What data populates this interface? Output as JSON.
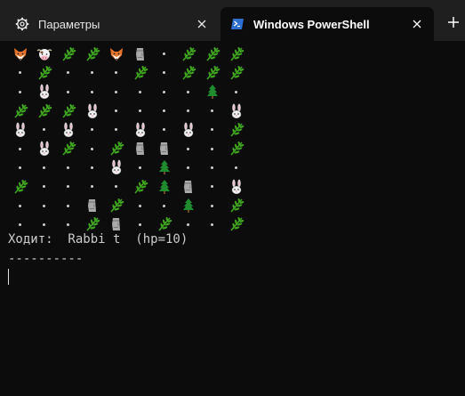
{
  "tabs": [
    {
      "label": "Параметры",
      "icon": "gear-icon",
      "active": false
    },
    {
      "label": "Windows PowerShell",
      "icon": "powershell-icon",
      "active": true
    }
  ],
  "terminal": {
    "grid": [
      [
        "fox",
        "cow",
        "herb",
        "herb",
        "fox",
        "moai",
        "dot",
        "herb",
        "herb",
        "herb"
      ],
      [
        "dot",
        "herb",
        "dot",
        "dot",
        "dot",
        "herb",
        "dot",
        "herb",
        "herb",
        "herb"
      ],
      [
        "dot",
        "rabbit",
        "dot",
        "dot",
        "dot",
        "dot",
        "dot",
        "dot",
        "tree",
        "dot"
      ],
      [
        "herb",
        "herb",
        "herb",
        "rabbit",
        "dot",
        "dot",
        "dot",
        "dot",
        "dot",
        "rabbit"
      ],
      [
        "rabbit",
        "dot",
        "rabbit",
        "dot",
        "dot",
        "rabbit",
        "dot",
        "rabbit",
        "dot",
        "herb"
      ],
      [
        "dot",
        "rabbit",
        "herb",
        "dot",
        "herb",
        "moai",
        "moai",
        "dot",
        "dot",
        "herb"
      ],
      [
        "dot",
        "dot",
        "dot",
        "dot",
        "rabbit",
        "dot",
        "tree",
        "dot",
        "dot",
        "dot"
      ],
      [
        "herb",
        "dot",
        "dot",
        "dot",
        "dot",
        "herb",
        "tree",
        "moai",
        "dot",
        "rabbit"
      ],
      [
        "dot",
        "dot",
        "dot",
        "moai",
        "herb",
        "dot",
        "dot",
        "tree",
        "dot",
        "herb"
      ],
      [
        "dot",
        "dot",
        "dot",
        "herb",
        "moai",
        "dot",
        "herb",
        "dot",
        "dot",
        "herb"
      ]
    ],
    "status_line": "Ходит:  Rabbi t  (hp=10)",
    "separator_line": "----------"
  },
  "colors": {
    "tabbar": "#1f1f1f",
    "terminal_bg": "#0c0c0c",
    "herb": "#3fa51f",
    "tree": "#1f8a2e",
    "powershell_blue": "#2d6fd1"
  }
}
